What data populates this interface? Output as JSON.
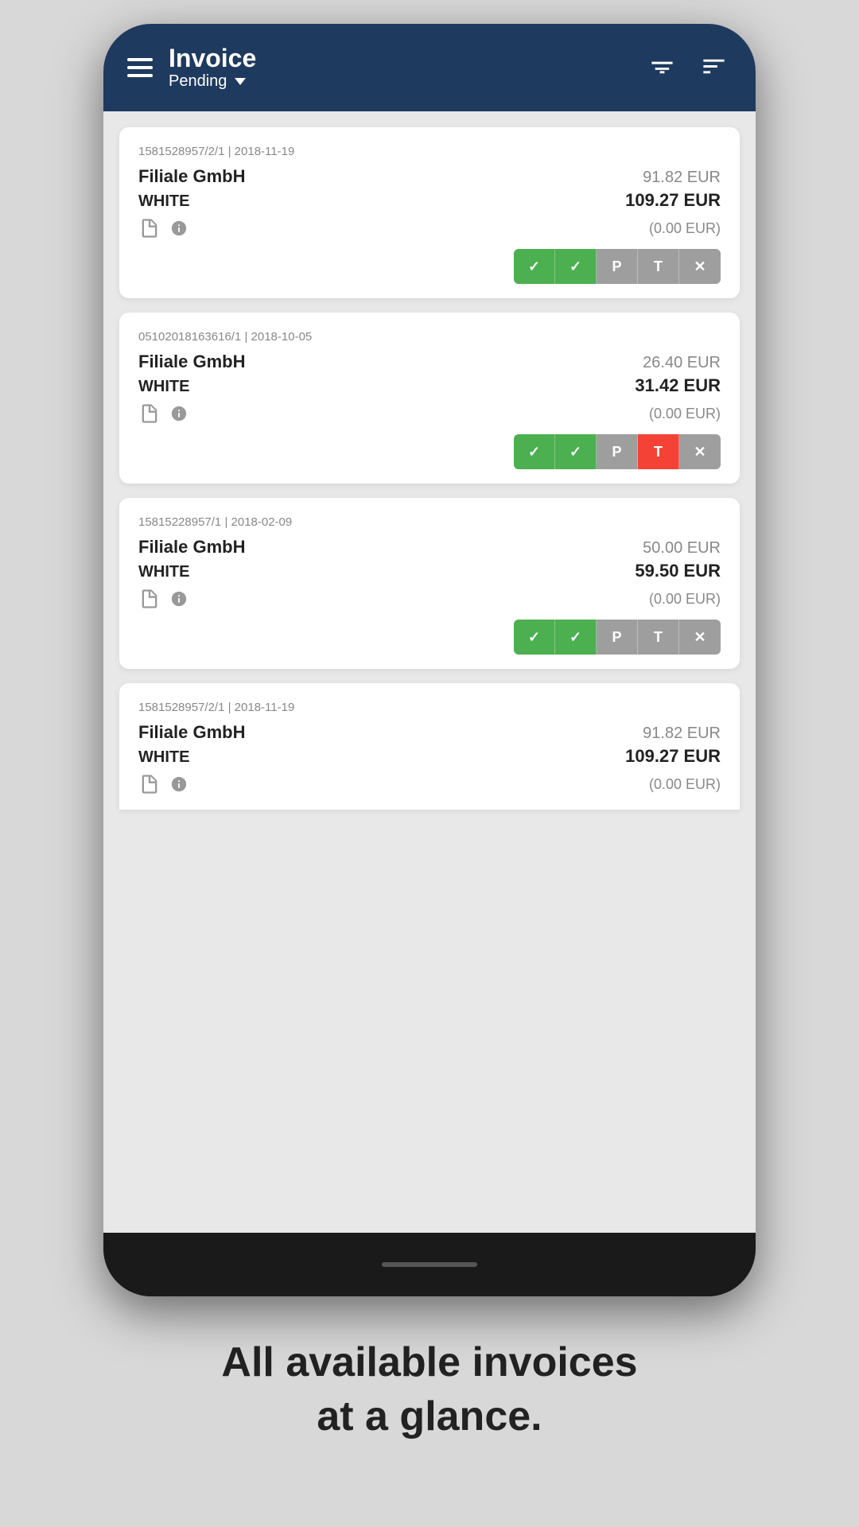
{
  "header": {
    "title": "Invoice",
    "subtitle": "Pending",
    "menu_label": "Menu",
    "filter_label": "Filter",
    "sort_label": "Sort"
  },
  "invoices": [
    {
      "id": "inv-1",
      "meta": "1581528957/2/1 | 2018-11-19",
      "company": "Filiale GmbH",
      "amount_primary": "91.82 EUR",
      "type": "WHITE",
      "amount_bold": "109.27 EUR",
      "amount_small": "(0.00 EUR)",
      "buttons": [
        {
          "label": "✓",
          "type": "check1",
          "class": "btn-check1"
        },
        {
          "label": "✓",
          "type": "check2",
          "class": "btn-check2"
        },
        {
          "label": "P",
          "type": "p",
          "class": "btn-p"
        },
        {
          "label": "T",
          "type": "t",
          "class": "btn-t"
        },
        {
          "label": "✕",
          "type": "x",
          "class": "btn-x"
        }
      ]
    },
    {
      "id": "inv-2",
      "meta": "05102018163616/1 | 2018-10-05",
      "company": "Filiale GmbH",
      "amount_primary": "26.40 EUR",
      "type": "WHITE",
      "amount_bold": "31.42 EUR",
      "amount_small": "(0.00 EUR)",
      "buttons": [
        {
          "label": "✓",
          "type": "check1",
          "class": "btn-check1"
        },
        {
          "label": "✓",
          "type": "check2",
          "class": "btn-check2"
        },
        {
          "label": "P",
          "type": "p",
          "class": "btn-p"
        },
        {
          "label": "T",
          "type": "t-active",
          "class": "btn-t-active"
        },
        {
          "label": "✕",
          "type": "x",
          "class": "btn-x"
        }
      ]
    },
    {
      "id": "inv-3",
      "meta": "15815228957/1 | 2018-02-09",
      "company": "Filiale GmbH",
      "amount_primary": "50.00 EUR",
      "type": "WHITE",
      "amount_bold": "59.50 EUR",
      "amount_small": "(0.00 EUR)",
      "buttons": [
        {
          "label": "✓",
          "type": "check1",
          "class": "btn-check1"
        },
        {
          "label": "✓",
          "type": "check2",
          "class": "btn-check2"
        },
        {
          "label": "P",
          "type": "p",
          "class": "btn-p"
        },
        {
          "label": "T",
          "type": "t",
          "class": "btn-t"
        },
        {
          "label": "✕",
          "type": "x",
          "class": "btn-x"
        }
      ]
    },
    {
      "id": "inv-4",
      "meta": "1581528957/2/1 | 2018-11-19",
      "company": "Filiale GmbH",
      "amount_primary": "91.82 EUR",
      "type": "WHITE",
      "amount_bold": "109.27 EUR",
      "amount_small": "(0.00 EUR)",
      "partial": true
    }
  ],
  "bottom_text": {
    "line1": "All available invoices",
    "line2": "at a glance."
  }
}
